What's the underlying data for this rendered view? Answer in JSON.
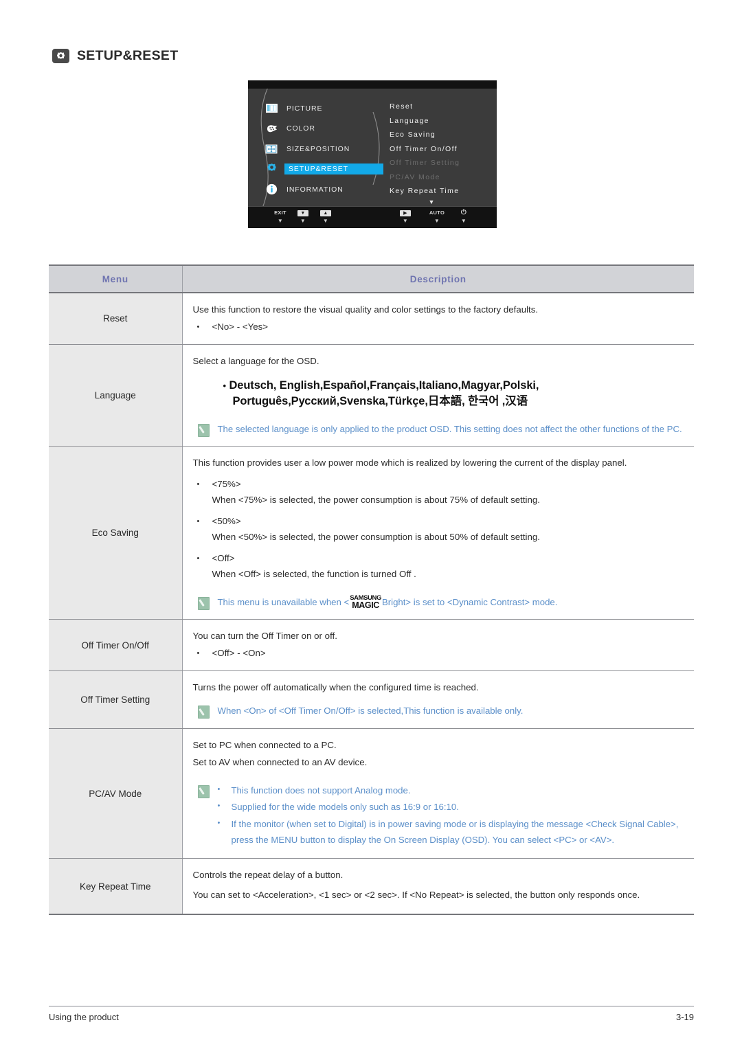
{
  "header": {
    "title": "SETUP&RESET",
    "icon": "setup-reset-icon"
  },
  "osd": {
    "left_menu": [
      {
        "label": "PICTURE",
        "icon": "picture-icon",
        "selected": false
      },
      {
        "label": "COLOR",
        "icon": "color-icon",
        "selected": false
      },
      {
        "label": "SIZE&POSITION",
        "icon": "size-position-icon",
        "selected": false
      },
      {
        "label": "SETUP&RESET",
        "icon": "gear-icon",
        "selected": true
      },
      {
        "label": "INFORMATION",
        "icon": "info-icon",
        "selected": false
      }
    ],
    "submenu": [
      {
        "label": "Reset",
        "disabled": false
      },
      {
        "label": "Language",
        "disabled": false
      },
      {
        "label": "Eco Saving",
        "disabled": false
      },
      {
        "label": "Off Timer On/Off",
        "disabled": false
      },
      {
        "label": "Off Timer Setting",
        "disabled": true
      },
      {
        "label": "PC/AV Mode",
        "disabled": true
      },
      {
        "label": "Key Repeat Time",
        "disabled": false
      }
    ],
    "scroll_arrow": "▼",
    "buttons": [
      {
        "caption": "EXIT",
        "type": "text",
        "tri": "▼"
      },
      {
        "caption": "▼",
        "type": "key",
        "tri": "▼"
      },
      {
        "caption": "▲",
        "type": "key",
        "tri": "▼"
      },
      {
        "caption": "▶",
        "type": "key",
        "tri": "▼"
      },
      {
        "caption": "AUTO",
        "type": "text",
        "tri": "▼"
      },
      {
        "caption": "⏻",
        "type": "power",
        "tri": "▼"
      }
    ],
    "highlight_color": "#12a9e8"
  },
  "table": {
    "headers": {
      "menu": "Menu",
      "description": "Description"
    },
    "rows": [
      {
        "menu": "Reset",
        "lines": [
          "Use this function to restore the visual quality and color settings to the factory defaults."
        ],
        "bullets": [
          "<No> - <Yes>"
        ]
      },
      {
        "menu": "Language",
        "lines": [
          "Select a language for the OSD."
        ],
        "languages_line1": "Deutsch, English,Español,Français,Italiano,Magyar,Polski,",
        "languages_line2": "Português,Русский,Svenska,Türkçe,日本語, 한국어 ,汉语",
        "note": "The selected language is only applied to the product OSD. This setting does not affect the other functions of the PC."
      },
      {
        "menu": "Eco Saving",
        "lines": [
          "This function provides user a low power mode which is realized by lowering the current of the display panel."
        ],
        "items": [
          {
            "bullet": "<75%>",
            "detail": "When <75%> is selected, the power consumption is about 75% of default setting."
          },
          {
            "bullet": "<50%>",
            "detail": "When <50%> is selected, the power consumption is about 50% of default setting."
          },
          {
            "bullet": "<Off>",
            "detail": "When <Off> is selected, the function is turned Off ."
          }
        ],
        "note_pre": "This menu is unavailable when <",
        "note_logo_line1": "SAMSUNG",
        "note_logo_line2": "MAGIC",
        "note_post": "Bright> is set to <Dynamic Contrast> mode."
      },
      {
        "menu": "Off Timer On/Off",
        "lines": [
          "You can turn the Off Timer on or off."
        ],
        "bullets": [
          "<Off> - <On>"
        ]
      },
      {
        "menu": "Off Timer Setting",
        "lines": [
          "Turns the power off automatically when the configured time is reached."
        ],
        "note": "When <On> of <Off Timer On/Off> is selected,This function is available only."
      },
      {
        "menu": "PC/AV Mode",
        "lines": [
          "Set to PC when connected to a PC.",
          "Set to AV when connected to an AV device."
        ],
        "note_bullets": [
          "This function does not support Analog mode.",
          "Supplied for the wide models only such as 16:9 or 16:10.",
          "If the monitor (when set to Digital) is in power saving mode or is displaying the message <Check Signal Cable>, press the MENU button to display the On Screen Display (OSD). You can select <PC> or <AV>."
        ]
      },
      {
        "menu": "Key Repeat Time",
        "lines": [
          "Controls the repeat delay of a button.",
          "You can set to <Acceleration>, <1 sec> or <2 sec>. If <No Repeat> is selected, the button only responds once."
        ]
      }
    ]
  },
  "footer": {
    "left": "Using the product",
    "right": "3-19"
  }
}
